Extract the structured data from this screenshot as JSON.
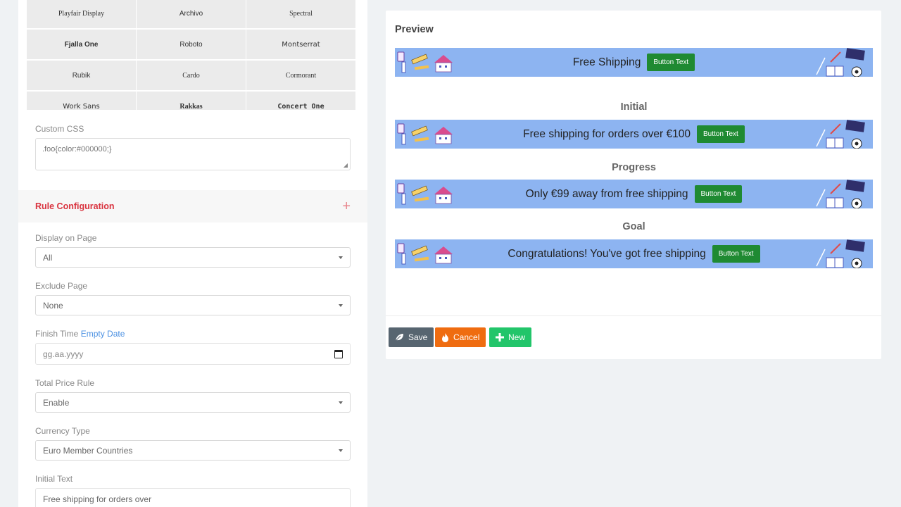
{
  "fonts": [
    {
      "label": "Playfair Display",
      "family": "\"Liberation Serif\", serif",
      "weight": "normal"
    },
    {
      "label": "Archivo",
      "family": "\"Liberation Sans\", sans-serif",
      "weight": "normal"
    },
    {
      "label": "Spectral",
      "family": "\"Liberation Serif\", serif",
      "weight": "normal"
    },
    {
      "label": "Fjalla One",
      "family": "\"Liberation Sans\", sans-serif",
      "weight": "bold"
    },
    {
      "label": "Roboto",
      "family": "\"Liberation Sans\", sans-serif",
      "weight": "normal"
    },
    {
      "label": "Montserrat",
      "family": "\"DejaVu Sans\", sans-serif",
      "weight": "normal"
    },
    {
      "label": "Rubik",
      "family": "\"Liberation Sans\", sans-serif",
      "weight": "normal"
    },
    {
      "label": "Cardo",
      "family": "\"Liberation Serif\", serif",
      "weight": "normal"
    },
    {
      "label": "Cormorant",
      "family": "\"Liberation Serif\", serif",
      "weight": "normal"
    },
    {
      "label": "Work Sans",
      "family": "\"DejaVu Sans\", sans-serif",
      "weight": "normal"
    },
    {
      "label": "Rakkas",
      "family": "\"Liberation Serif\", serif",
      "weight": "bold"
    },
    {
      "label": "Concert One",
      "family": "\"DejaVu Sans Mono\", monospace",
      "weight": "bold"
    }
  ],
  "custom_css": {
    "label": "Custom CSS",
    "value": ".foo{color:#000000;}"
  },
  "rule_config": {
    "title": "Rule Configuration",
    "plus": "+"
  },
  "display_on_page": {
    "label": "Display on Page",
    "value": "All"
  },
  "exclude_page": {
    "label": "Exclude Page",
    "value": "None"
  },
  "finish_time": {
    "label": "Finish Time",
    "link": "Empty Date",
    "placeholder": "gg.aa.yyyy"
  },
  "total_price_rule": {
    "label": "Total Price Rule",
    "value": "Enable"
  },
  "currency_type": {
    "label": "Currency Type",
    "value": "Euro Member Countries"
  },
  "initial_text": {
    "label": "Initial Text",
    "value": "Free shipping for orders over"
  },
  "preview": {
    "title": "Preview",
    "banner_color": "#8db4f1",
    "button_color": "#1f8a32",
    "main": {
      "text": "Free Shipping",
      "button": "Button Text"
    },
    "stages": [
      {
        "label": "Initial",
        "text": "Free shipping for orders over €100",
        "button": "Button Text"
      },
      {
        "label": "Progress",
        "text": "Only €99 away from free shipping",
        "button": "Button Text"
      },
      {
        "label": "Goal",
        "text": "Congratulations! You've got free shipping",
        "button": "Button Text"
      }
    ]
  },
  "actions": {
    "save": "Save",
    "cancel": "Cancel",
    "new": "New"
  }
}
